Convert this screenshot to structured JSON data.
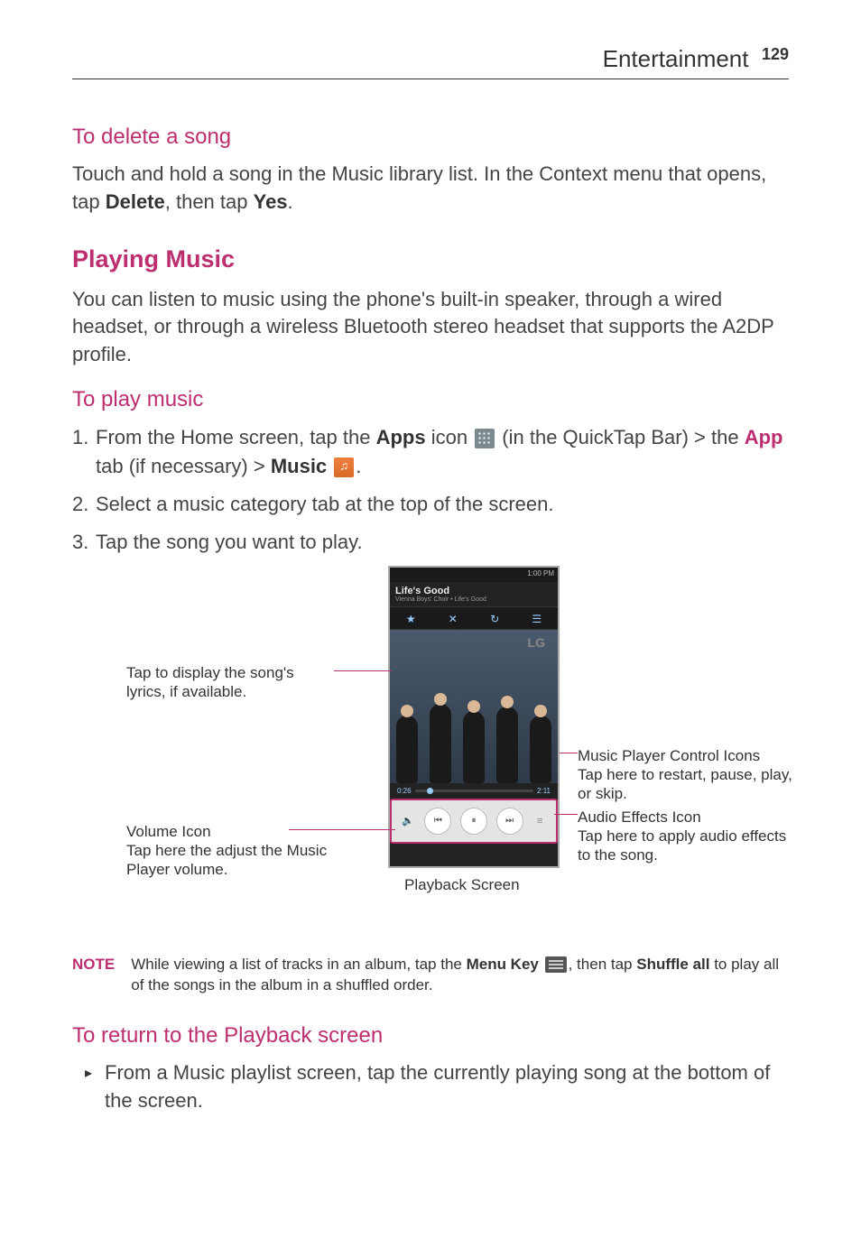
{
  "header": {
    "section": "Entertainment",
    "page_number": "129"
  },
  "delete_song": {
    "heading": "To delete a song",
    "text_before_delete": "Touch and hold a song in the Music library list. In the Context menu that opens, tap ",
    "delete_word": "Delete",
    "text_mid": ", then tap ",
    "yes_word": "Yes",
    "text_after": "."
  },
  "playing_music": {
    "heading": "Playing Music",
    "text": "You can listen to music using the phone's built-in speaker, through a wired headset, or through a wireless Bluetooth stereo headset that supports the A2DP profile."
  },
  "to_play": {
    "heading": "To play music",
    "step1_before_apps": "From the Home screen, tap the ",
    "step1_apps": "Apps",
    "step1_after_apps": " icon ",
    "step1_after_icon": " (in the QuickTap Bar) > the ",
    "step1_app_tab": "App",
    "step1_tab_text": " tab (if necessary) > ",
    "step1_music": "Music",
    "step1_end": " .",
    "step2": "Select a music category tab at the top of the screen.",
    "step3": "Tap the song you want to play."
  },
  "phone": {
    "status_time": "1:00 PM",
    "song_title": "Life's Good",
    "song_artist": "Vienna Boys' Choir • Life's Good",
    "tab_star": "★",
    "tab_shuffle": "✕",
    "tab_repeat": "↻",
    "tab_queue": "☰",
    "lg_logo": "LG",
    "time_cur": "0:26",
    "time_end": "2:11",
    "btn_vol": "🔈",
    "btn_prev": "⏮",
    "btn_play": "⏸",
    "btn_next": "⏭",
    "btn_fx": "≡"
  },
  "callouts": {
    "lyrics": "Tap to display the song's lyrics, if available.",
    "volume_title": "Volume Icon",
    "volume_body": "Tap here the adjust the Music Player volume.",
    "control_title": "Music Player Control Icons",
    "control_body": "Tap here to restart, pause, play, or skip.",
    "effects_title": "Audio Effects Icon",
    "effects_body": "Tap here to apply audio effects to the song.",
    "playback_label": "Playback Screen"
  },
  "note": {
    "label": "NOTE",
    "t1": "While viewing a list of tracks in an album, tap the ",
    "menu_key": "Menu Key",
    "t2": ", then tap ",
    "shuffle_all": "Shuffle all",
    "t3": " to play all of the songs in the album in a shuffled order."
  },
  "return_section": {
    "heading": "To return to the Playback screen",
    "bullet": "From a Music playlist screen, tap the currently playing song at the bottom of the screen."
  }
}
